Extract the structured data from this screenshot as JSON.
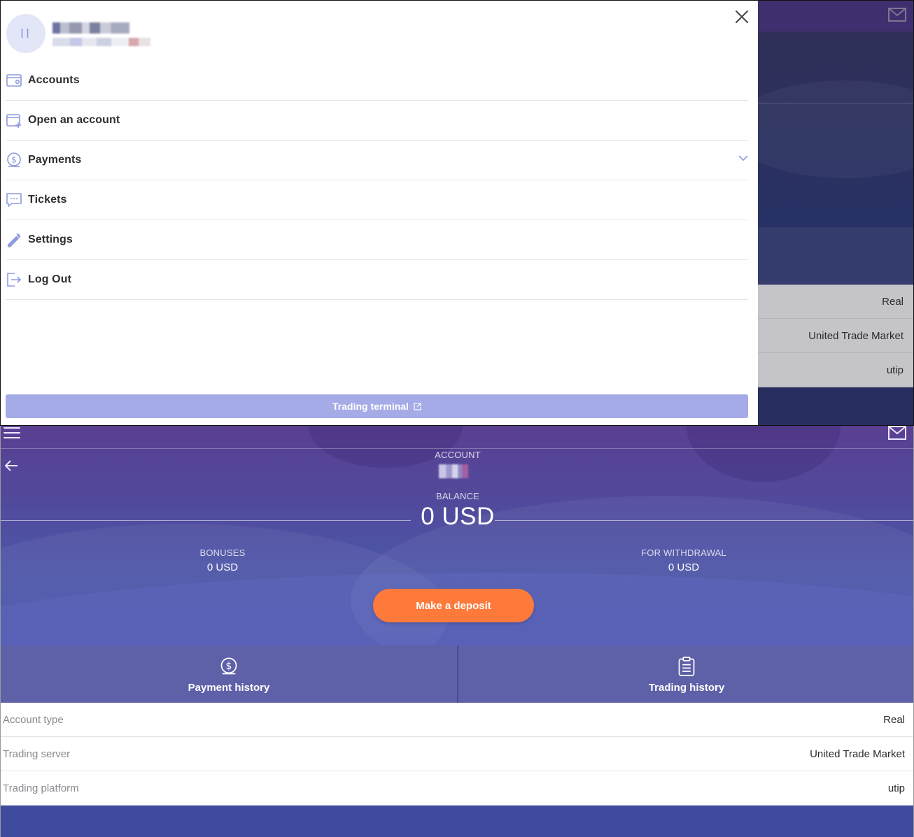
{
  "sidebar": {
    "avatar_initials": "II",
    "menu": [
      {
        "label": "Accounts",
        "icon": "wallet-icon"
      },
      {
        "label": "Open an account",
        "icon": "add-account-icon"
      },
      {
        "label": "Payments",
        "icon": "dollar-coin-icon",
        "expandable": true
      },
      {
        "label": "Tickets",
        "icon": "chat-bubble-icon"
      },
      {
        "label": "Settings",
        "icon": "wrench-icon"
      },
      {
        "label": "Log Out",
        "icon": "logout-icon"
      }
    ],
    "terminal_label": "Trading terminal"
  },
  "background_rows": [
    {
      "value": "Real"
    },
    {
      "value": "United Trade Market"
    },
    {
      "value": "utip"
    }
  ],
  "account": {
    "account_label": "ACCOUNT",
    "balance_label": "BALANCE",
    "balance_value": "0 USD",
    "bonuses_label": "BONUSES",
    "bonuses_value": "0 USD",
    "withdrawal_label": "FOR WITHDRAWAL",
    "withdrawal_value": "0 USD",
    "deposit_label": "Make a deposit"
  },
  "tabs": [
    {
      "label": "Payment history",
      "icon": "dollar-coin-icon"
    },
    {
      "label": "Trading history",
      "icon": "clipboard-icon"
    }
  ],
  "details": [
    {
      "key": "Account type",
      "value": "Real"
    },
    {
      "key": "Trading server",
      "value": "United Trade Market"
    },
    {
      "key": "Trading platform",
      "value": "utip"
    }
  ],
  "colors": {
    "accent": "#8e9ae0",
    "deposit": "#fd7a3a",
    "hero_top": "#5a3f92",
    "hero_bottom": "#4953ac",
    "tabs_bg": "#5e60a8",
    "terminal_btn": "#a5abe6"
  }
}
